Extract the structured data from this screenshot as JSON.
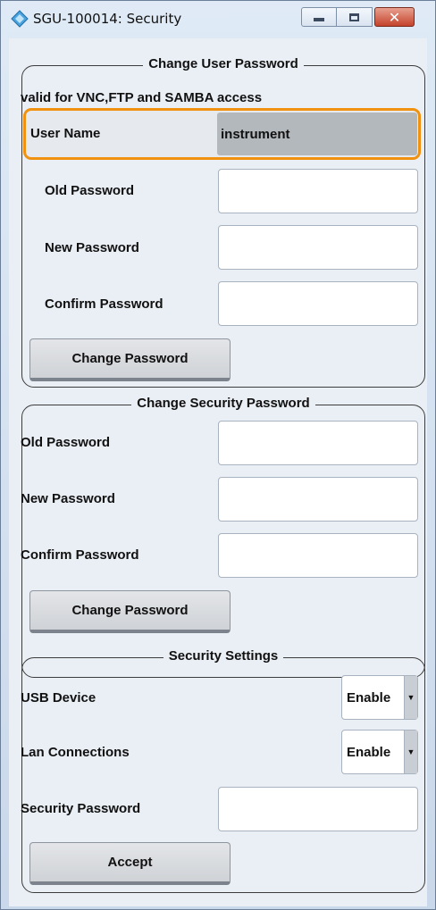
{
  "window": {
    "title": "SGU-100014: Security",
    "close_glyph": "✕"
  },
  "user_password": {
    "legend": "Change User Password",
    "note": "valid for VNC,FTP and SAMBA access",
    "user_name_label": "User Name",
    "user_name_value": "instrument",
    "old_label": "Old Password",
    "old_value": "",
    "new_label": "New Password",
    "new_value": "",
    "confirm_label": "Confirm Password",
    "confirm_value": "",
    "button": "Change Password"
  },
  "security_password": {
    "legend": "Change Security Password",
    "old_label": "Old Password",
    "old_value": "",
    "new_label": "New Password",
    "new_value": "",
    "confirm_label": "Confirm Password",
    "confirm_value": "",
    "button": "Change Password"
  },
  "security_settings": {
    "legend": "Security Settings",
    "usb_label": "USB Device",
    "usb_value": "Enable",
    "lan_label": "Lan Connections",
    "lan_value": "Enable",
    "sec_pw_label": "Security Password",
    "sec_pw_value": "",
    "button": "Accept"
  },
  "colors": {
    "focus_highlight": "#f0920f",
    "close_button": "#c4432c"
  }
}
